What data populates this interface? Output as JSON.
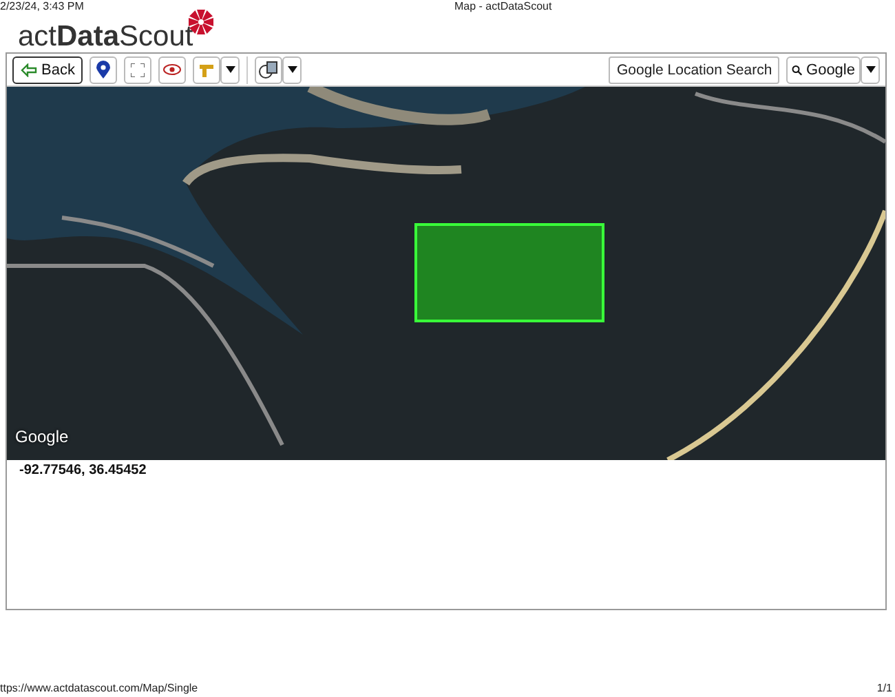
{
  "print_header": {
    "date": "2/23/24, 3:43 PM",
    "title": "Map - actDataScout"
  },
  "logo": {
    "text": "act**Data**Scout"
  },
  "toolbar": {
    "back_button": "Back",
    "search": {
      "placeholder": "Google Location Search"
    },
    "provider_button": "Google"
  },
  "map": {
    "attribution": "Google"
  },
  "coordinates": "-92.77546, 36.45452",
  "print_footer": {
    "url": "ttps://www.actdatascout.com/Map/Single",
    "page": "1/1"
  }
}
